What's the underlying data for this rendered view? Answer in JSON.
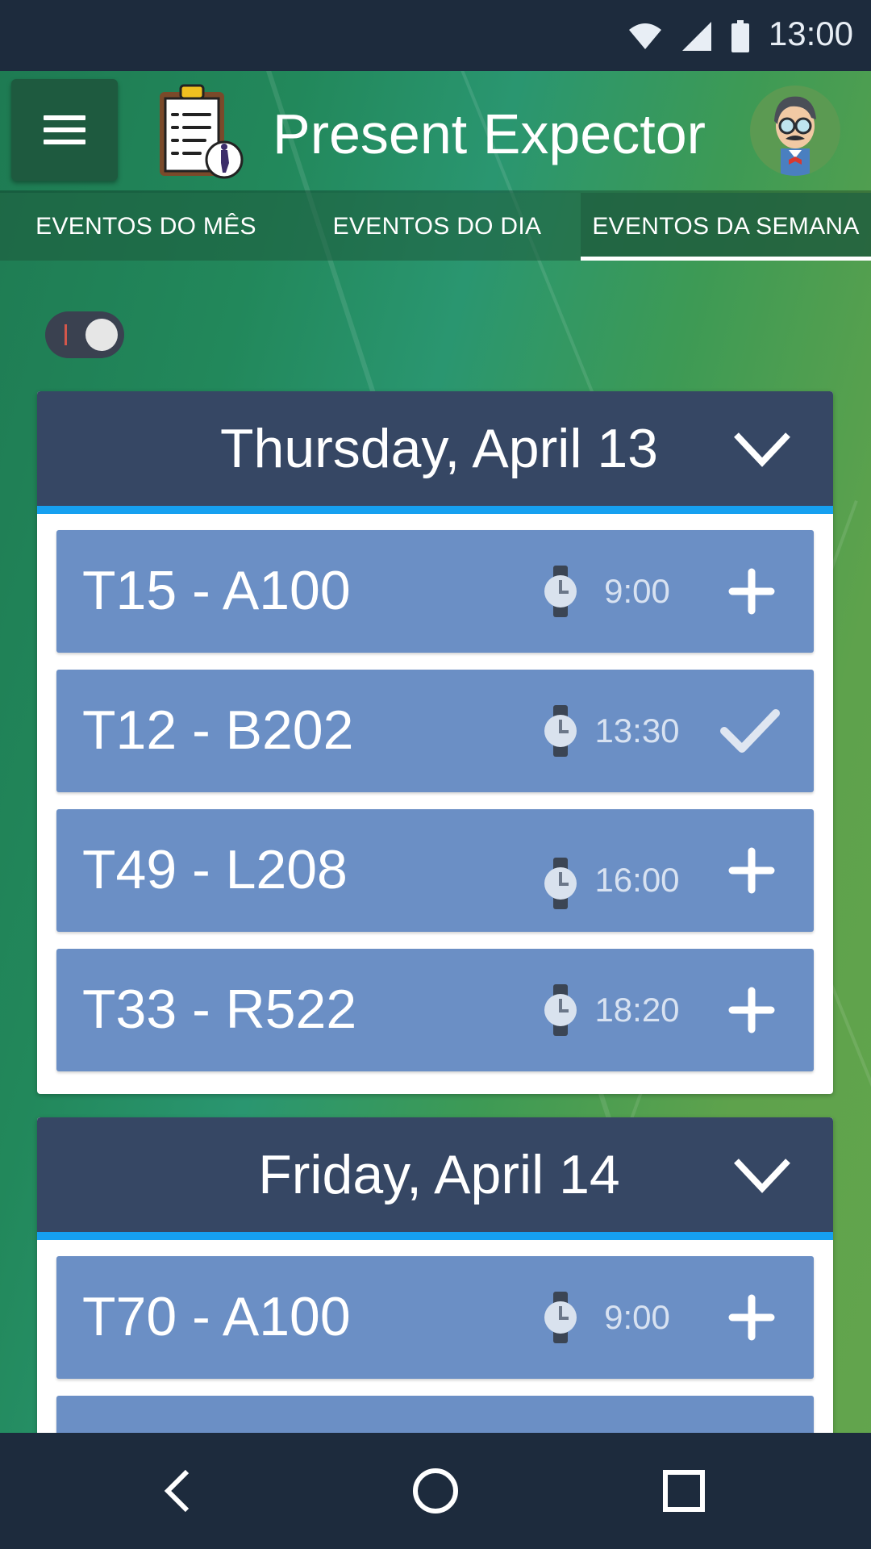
{
  "status_bar": {
    "time": "13:00",
    "icons": [
      "wifi-icon",
      "signal-icon",
      "battery-icon"
    ]
  },
  "app_bar": {
    "title": "Present Expector",
    "menu_icon": "hamburger-icon",
    "logo_icon": "clipboard-checklist-icon",
    "avatar_icon": "user-avatar-icon"
  },
  "tabs": [
    {
      "label": "EVENTOS DO MÊS",
      "active": false
    },
    {
      "label": "EVENTOS DO DIA",
      "active": false
    },
    {
      "label": "EVENTOS DA SEMANA",
      "active": true
    }
  ],
  "toggle": {
    "on": false
  },
  "days": [
    {
      "title": "Thursday, April 13",
      "events": [
        {
          "name": "T15 - A100",
          "time": "9:00",
          "status": "add"
        },
        {
          "name": "T12 - B202",
          "time": "13:30",
          "status": "checked"
        },
        {
          "name": "T49 - L208",
          "time": "16:00",
          "status": "add"
        },
        {
          "name": "T33 - R522",
          "time": "18:20",
          "status": "add"
        }
      ]
    },
    {
      "title": "Friday, April 14",
      "events": [
        {
          "name": "T70 - A100",
          "time": "9:00",
          "status": "add"
        }
      ]
    }
  ],
  "nav_bar": {
    "back_icon": "back-icon",
    "home_icon": "home-icon",
    "recents_icon": "recents-icon"
  },
  "colors": {
    "header": "#364764",
    "accent": "#16a0f0",
    "event": "#6b8fc5",
    "bar": "#1d2b3d"
  }
}
